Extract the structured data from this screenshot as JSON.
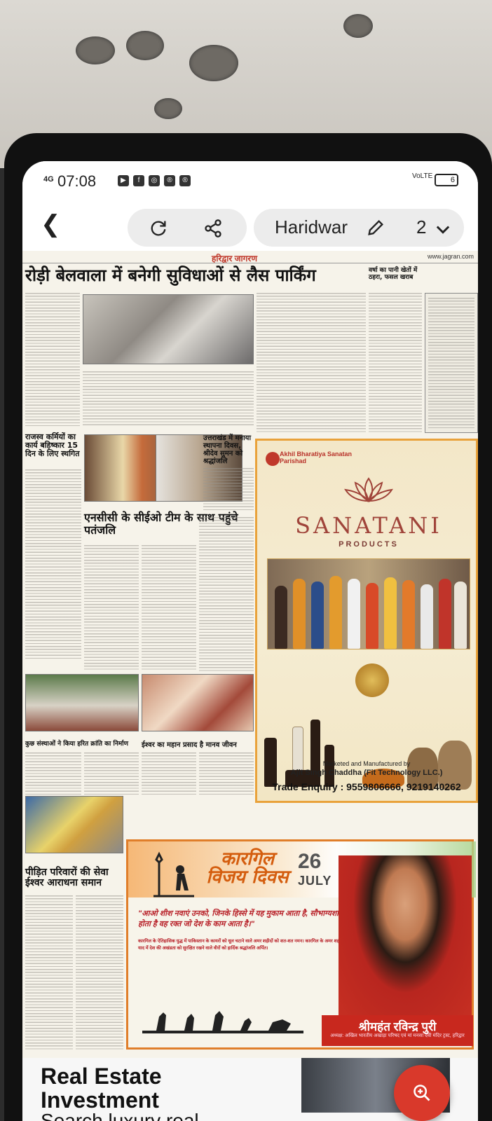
{
  "status_bar": {
    "network": "4G",
    "time": "07:08",
    "signal_label": "VoLTE",
    "battery": "6"
  },
  "toolbar": {
    "edition": "Haridwar",
    "page_number": "2"
  },
  "newspaper": {
    "masthead_center": "हरिद्वार जागरण",
    "masthead_right": "www.jagran.com",
    "headline_main": "रोड़ी बेलवाला में बनेगी सुविधाओं से लैस पार्किंग",
    "headline_side": "वर्षा का पानी खेतों में ठहरा, फसल खराब",
    "headline_employees": "राजस्व कर्मियों का कार्य बहिष्कार 15 दिन के लिए स्थगित",
    "headline_uttarakhand": "उत्तराखंड में मनाया स्थापना दिवस, श्रीदेव सुमन को श्रद्धांजलि",
    "headline_ncc": "एनसीसी के सीईओ टीम के साथ पहुंचे पतंजलि",
    "headline_tree": "कुछ संस्थाओं ने किया हरित क्रांति का निर्माण",
    "headline_god": "ईश्वर का महान प्रसाद है मानव जीवन",
    "headline_service": "पीड़ित परिवारों की सेवा ईश्वर आराधना समान"
  },
  "ad_sanatani": {
    "org": "Akhil Bharatiya Sanatan Parishad",
    "brand": "SANATANI",
    "tagline": "PRODUCTS",
    "marketed_by": "Marketed and Manufactured by",
    "company": "Ajit Singh Chaddha (Fit Technology LLC.)",
    "trade_enquiry": "Trade Enquiry : 9559806666, 9219140262"
  },
  "ad_kargil": {
    "title": "कारगिल विजय दिवस",
    "date_num": "26",
    "date_month": "JULY",
    "quote": "\"आओ शीश नवाएं उनको, जिनके हिस्से में यह मुकाम आता है, सौभाग्यशाली होता है वह रक्त जो देश के काम आता है।\"",
    "body": "कारगिल के ऐतिहासिक युद्ध में पाकिस्तान के कायरों को धूल चटाने वाले अमर शहीदों को शत-शत नमन। कारगिल के अमर शहीदों की याद में देश की अखंडता को सुरक्षित रखने वाले वीरों को हार्दिक श्रद्धांजलि अर्पित।",
    "name": "श्रीमहंत रविन्द्र पुरी",
    "role": "अध्यक्ष: अखिल भारतीय अखाड़ा परिषद एवं मां मनसा देवी मंदिर ट्रस्ट, हरिद्वार"
  },
  "bottom_ad": {
    "line1": "Real Estate",
    "line2": "Investment",
    "line3": "Search luxury real"
  }
}
